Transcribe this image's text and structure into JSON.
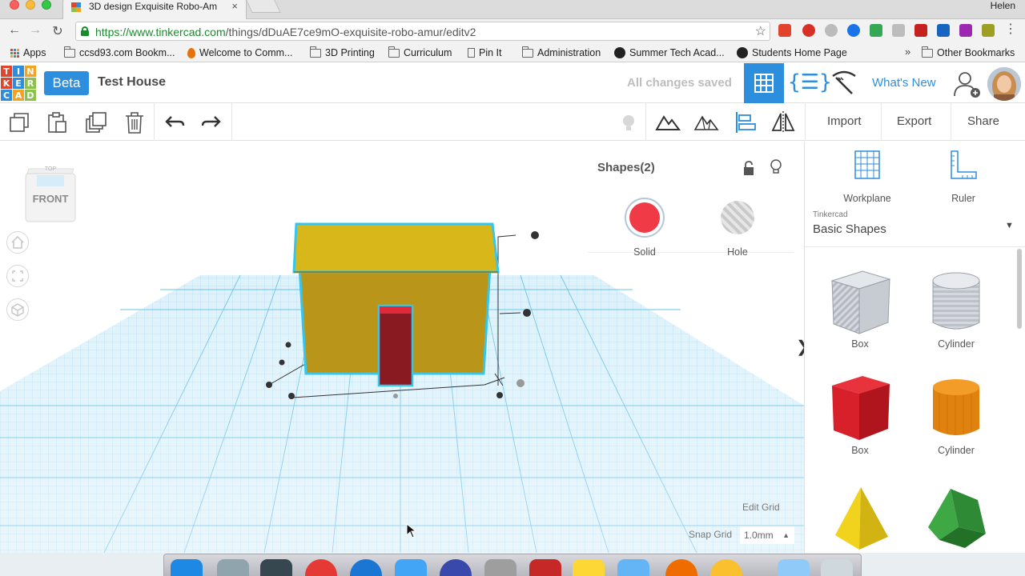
{
  "browser": {
    "tab_title": "3D design Exquisite Robo-Am",
    "tab_close": "×",
    "user_name": "Helen",
    "url_secure": "https://www.tinkercad.com",
    "url_path": "/things/dDuAE7ce9mO-exquisite-robo-amur/editv2",
    "back_icon": "←",
    "forward_icon": "→",
    "reload_icon": "↻",
    "star_icon": "☆",
    "menu_icon": "⋮",
    "bookmarks": [
      {
        "label": "Apps",
        "icon": "apps-grid-icon"
      },
      {
        "label": "ccsd93.com Bookm...",
        "icon": "folder-icon"
      },
      {
        "label": "Welcome to Comm...",
        "icon": "flame-icon"
      },
      {
        "label": "3D Printing",
        "icon": "folder-icon"
      },
      {
        "label": "Curriculum",
        "icon": "folder-icon"
      },
      {
        "label": "Pin It",
        "icon": "page-icon"
      },
      {
        "label": "Administration",
        "icon": "folder-icon"
      },
      {
        "label": "Summer Tech Acad...",
        "icon": "s-logo-icon"
      },
      {
        "label": "Students Home Page",
        "icon": "s-logo-icon"
      }
    ],
    "bookmarks_overflow": "»",
    "other_bookmarks": "Other Bookmarks"
  },
  "app": {
    "logo_letters": [
      "T",
      "I",
      "N",
      "K",
      "E",
      "R",
      "C",
      "A",
      "D"
    ],
    "logo_colors": [
      "#e2432b",
      "#2e8ede",
      "#f4a321",
      "#e2432b",
      "#2e8ede",
      "#8bc34a",
      "#2e8ede",
      "#f4a321",
      "#8bc34a"
    ],
    "beta_label": "Beta",
    "project_title": "Test House",
    "save_status": "All changes saved",
    "whats_new": "What's New",
    "brand_blue": "#2e8ede"
  },
  "toolbar": {
    "import_label": "Import",
    "export_label": "Export",
    "share_label": "Share"
  },
  "workspace": {
    "viewcube_label": "FRONT",
    "viewcube_top": "TOP",
    "inspector_title": "Shapes(2)",
    "solid_label": "Solid",
    "hole_label": "Hole",
    "edit_grid": "Edit Grid",
    "snap_grid_label": "Snap Grid",
    "snap_grid_value": "1.0mm",
    "snap_arrow": "▲",
    "collapse_icon": "❯"
  },
  "panel": {
    "workplane_label": "Workplane",
    "ruler_label": "Ruler",
    "library_source": "Tinkercad",
    "library_name": "Basic Shapes",
    "library_arrow": "▼",
    "shapes": [
      {
        "label": "Box",
        "kind": "box-hole"
      },
      {
        "label": "Cylinder",
        "kind": "cylinder-hole"
      },
      {
        "label": "Box",
        "kind": "box-red"
      },
      {
        "label": "Cylinder",
        "kind": "cylinder-orange"
      },
      {
        "label": "",
        "kind": "pyramid-yellow"
      },
      {
        "label": "",
        "kind": "roof-green"
      }
    ]
  }
}
